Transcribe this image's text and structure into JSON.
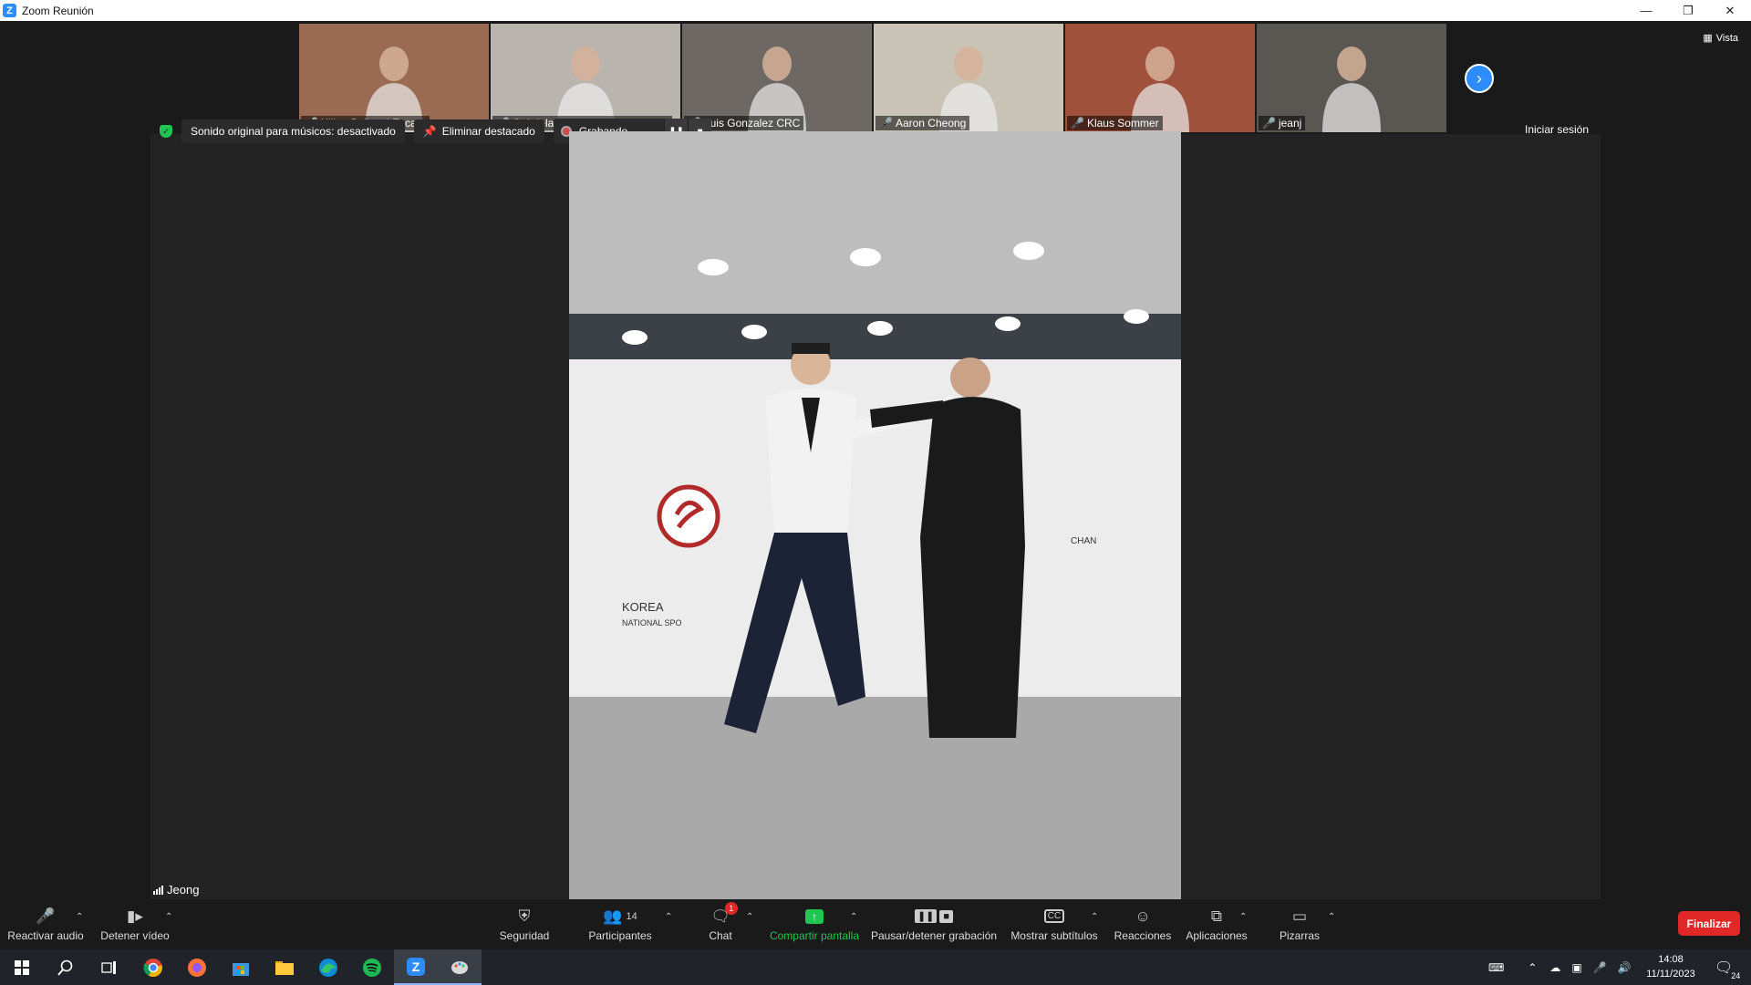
{
  "window": {
    "title": "Zoom Reunión",
    "controls": [
      "minimize",
      "restore",
      "close"
    ]
  },
  "thumbnails": [
    {
      "name": "Kilian Ballespi Escarp",
      "muted": true,
      "bg": "#9a6a52"
    },
    {
      "name": "Gabriela Echeverria - Him Yon...",
      "muted": true,
      "bg": "#b9b4ad"
    },
    {
      "name": "Luis Gonzalez CRC",
      "muted": true,
      "bg": "#6d6864"
    },
    {
      "name": "Aaron Cheong",
      "muted": true,
      "bg": "#c9c3b6"
    },
    {
      "name": "Klaus Sommer",
      "muted": true,
      "bg": "#a0513c"
    },
    {
      "name": "jeanj",
      "muted": true,
      "bg": "#5a5753"
    }
  ],
  "view_label": "Vista",
  "info": {
    "original_sound": "Sonido original para músicos: desactivado",
    "remove_spotlight": "Eliminar destacado",
    "recording": "Grabando...",
    "sign_in": "Iniciar sesión"
  },
  "speaker": {
    "name": "Jeong"
  },
  "toolbar": {
    "unmute": "Reactivar audio",
    "stop_video": "Detener vídeo",
    "security": "Seguridad",
    "participants": "Participantes",
    "participants_count": "14",
    "chat": "Chat",
    "chat_badge": "1",
    "share": "Compartir pantalla",
    "pause_rec": "Pausar/detener grabación",
    "captions": "Mostrar subtítulos",
    "reactions": "Reacciones",
    "apps": "Aplicaciones",
    "whiteboards": "Pizarras",
    "end": "Finalizar"
  },
  "taskbar": {
    "time": "14:08",
    "date": "11/11/2023",
    "notifications": "24"
  },
  "colors": {
    "accent": "#2d8cff",
    "share_green": "#23c552",
    "end_red": "#e02828"
  }
}
